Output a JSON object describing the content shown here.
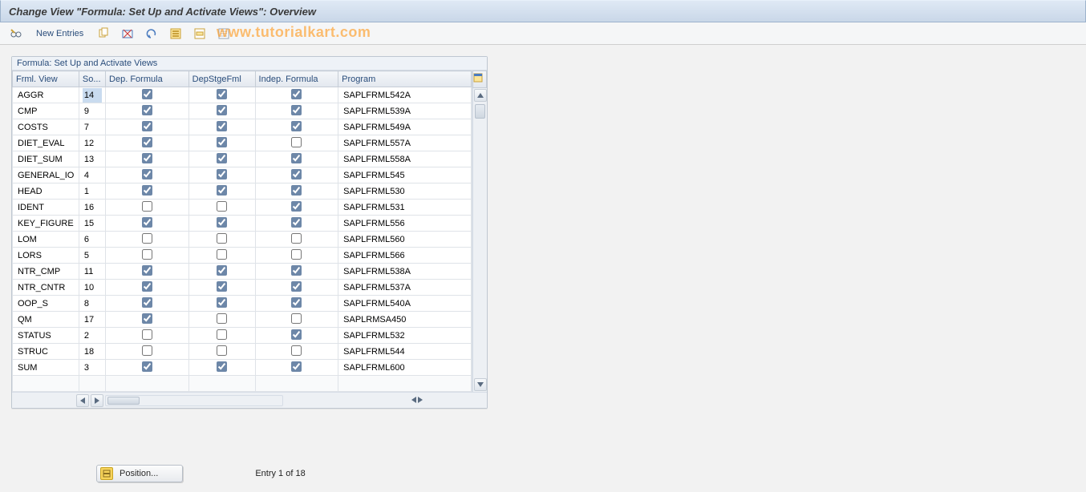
{
  "title": "Change View \"Formula: Set Up and Activate Views\": Overview",
  "toolbar": {
    "new_entries_label": "New Entries"
  },
  "watermark": "www.tutorialkart.com",
  "group": {
    "title": "Formula: Set Up and Activate Views"
  },
  "columns": {
    "frml_view": "Frml. View",
    "sort": "So...",
    "dep_formula": "Dep. Formula",
    "dep_stage": "DepStgeFml",
    "indep_formula": "Indep. Formula",
    "program": "Program"
  },
  "rows": [
    {
      "frml": "AGGR",
      "sort": "14",
      "dep": true,
      "stage": true,
      "indep": true,
      "program": "SAPLFRML542A",
      "selected": true
    },
    {
      "frml": "CMP",
      "sort": "9",
      "dep": true,
      "stage": true,
      "indep": true,
      "program": "SAPLFRML539A"
    },
    {
      "frml": "COSTS",
      "sort": "7",
      "dep": true,
      "stage": true,
      "indep": true,
      "program": "SAPLFRML549A"
    },
    {
      "frml": "DIET_EVAL",
      "sort": "12",
      "dep": true,
      "stage": true,
      "indep": false,
      "program": "SAPLFRML557A"
    },
    {
      "frml": "DIET_SUM",
      "sort": "13",
      "dep": true,
      "stage": true,
      "indep": true,
      "program": "SAPLFRML558A"
    },
    {
      "frml": "GENERAL_IO",
      "sort": "4",
      "dep": true,
      "stage": true,
      "indep": true,
      "program": "SAPLFRML545"
    },
    {
      "frml": "HEAD",
      "sort": "1",
      "dep": true,
      "stage": true,
      "indep": true,
      "program": "SAPLFRML530"
    },
    {
      "frml": "IDENT",
      "sort": "16",
      "dep": false,
      "stage": false,
      "indep": true,
      "program": "SAPLFRML531"
    },
    {
      "frml": "KEY_FIGURE",
      "sort": "15",
      "dep": true,
      "stage": true,
      "indep": true,
      "program": "SAPLFRML556"
    },
    {
      "frml": "LOM",
      "sort": "6",
      "dep": false,
      "stage": false,
      "indep": false,
      "program": "SAPLFRML560"
    },
    {
      "frml": "LORS",
      "sort": "5",
      "dep": false,
      "stage": false,
      "indep": false,
      "program": "SAPLFRML566"
    },
    {
      "frml": "NTR_CMP",
      "sort": "11",
      "dep": true,
      "stage": true,
      "indep": true,
      "program": "SAPLFRML538A"
    },
    {
      "frml": "NTR_CNTR",
      "sort": "10",
      "dep": true,
      "stage": true,
      "indep": true,
      "program": "SAPLFRML537A"
    },
    {
      "frml": "OOP_S",
      "sort": "8",
      "dep": true,
      "stage": true,
      "indep": true,
      "program": "SAPLFRML540A"
    },
    {
      "frml": "QM",
      "sort": "17",
      "dep": true,
      "stage": false,
      "indep": false,
      "program": "SAPLRMSA450"
    },
    {
      "frml": "STATUS",
      "sort": "2",
      "dep": false,
      "stage": false,
      "indep": true,
      "program": "SAPLFRML532"
    },
    {
      "frml": "STRUC",
      "sort": "18",
      "dep": false,
      "stage": false,
      "indep": false,
      "program": "SAPLFRML544"
    },
    {
      "frml": "SUM",
      "sort": "3",
      "dep": true,
      "stage": true,
      "indep": true,
      "program": "SAPLFRML600"
    }
  ],
  "footer": {
    "position_label": "Position...",
    "entry_status": "Entry 1 of 18"
  }
}
